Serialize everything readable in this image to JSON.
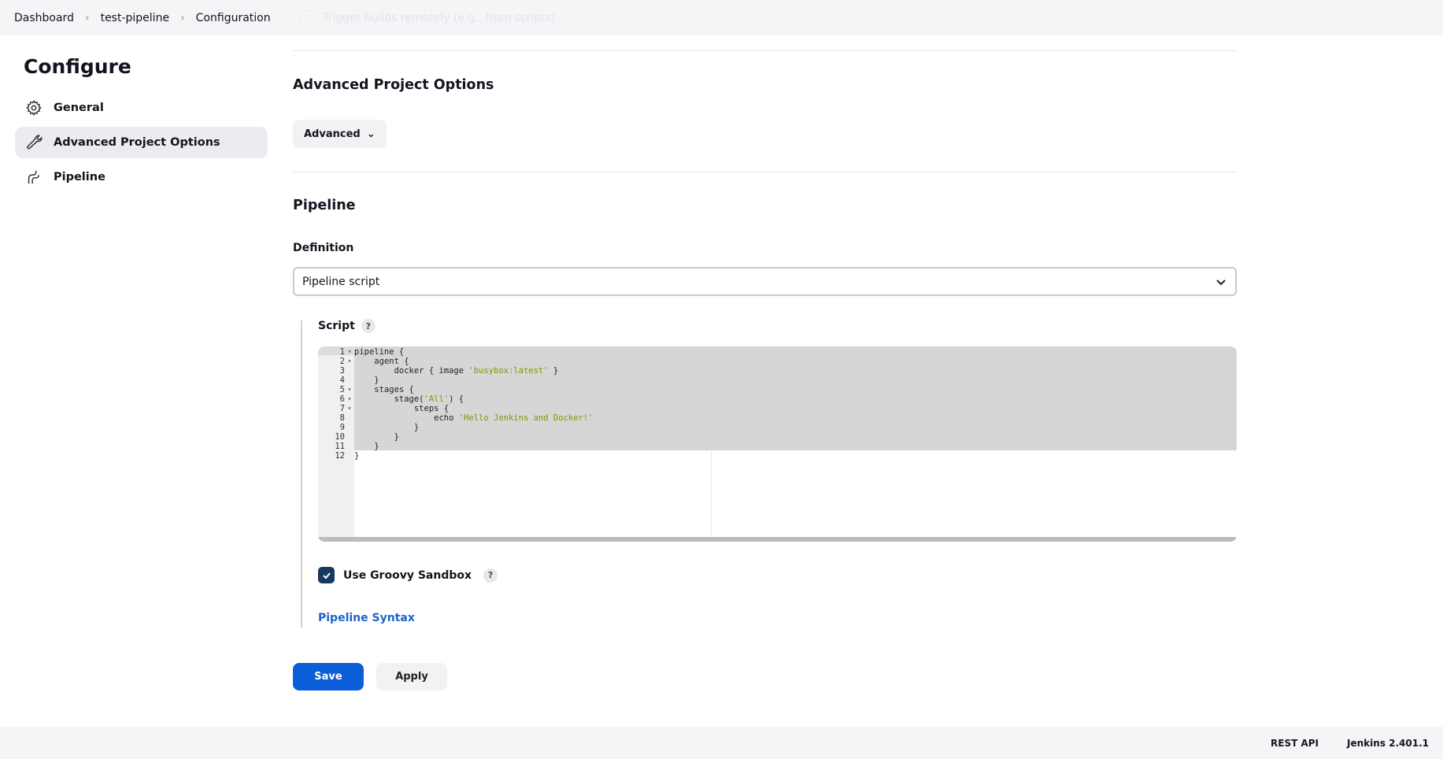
{
  "breadcrumb": [
    "Dashboard",
    "test-pipeline",
    "Configuration"
  ],
  "ghost_option": "Trigger builds remotely (e.g., from scripts)",
  "sidebar": {
    "title": "Configure",
    "items": [
      {
        "label": "General",
        "icon": "gear-icon"
      },
      {
        "label": "Advanced Project Options",
        "icon": "wrench-icon",
        "active": true
      },
      {
        "label": "Pipeline",
        "icon": "pipeline-icon"
      }
    ]
  },
  "advanced": {
    "heading": "Advanced Project Options",
    "button": "Advanced"
  },
  "pipeline": {
    "heading": "Pipeline",
    "definition_label": "Definition",
    "definition_value": "Pipeline script",
    "script_label": "Script",
    "help": "?",
    "script_lines": [
      "pipeline {",
      "    agent {",
      "        docker { image 'busybox:latest' }",
      "    }",
      "    stages {",
      "        stage('All') {",
      "            steps {",
      "                echo 'Hello Jenkins and Docker!'",
      "            }",
      "        }",
      "    }",
      "}"
    ],
    "foldable_lines": [
      1,
      2,
      5,
      6,
      7
    ],
    "sandbox_label": "Use Groovy Sandbox",
    "sandbox_checked": true,
    "syntax_link": "Pipeline Syntax"
  },
  "actions": {
    "save": "Save",
    "apply": "Apply"
  },
  "footer": {
    "rest_api": "REST API",
    "version": "Jenkins 2.401.1"
  },
  "colors": {
    "primary": "#0b5ed7",
    "checkbox": "#163a5f",
    "link": "#1e63c8"
  }
}
